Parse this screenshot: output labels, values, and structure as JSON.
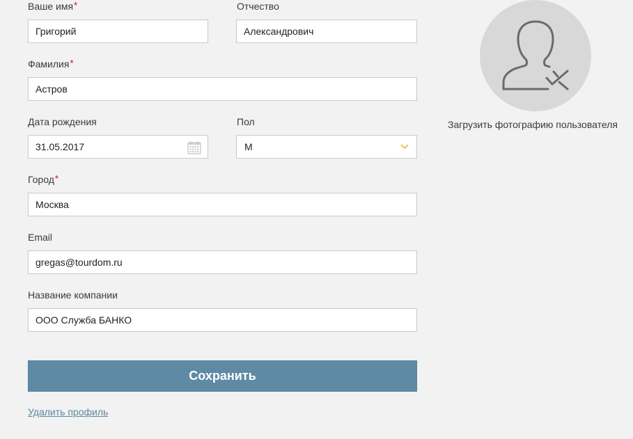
{
  "form": {
    "first_name": {
      "label": "Ваше имя",
      "required_mark": "*",
      "value": "Григорий"
    },
    "patronymic": {
      "label": "Отчество",
      "value": "Александрович"
    },
    "last_name": {
      "label": "Фамилия",
      "required_mark": "*",
      "value": "Астров"
    },
    "birth_date": {
      "label": "Дата рождения",
      "value": "31.05.2017",
      "icon": "calendar-icon"
    },
    "gender": {
      "label": "Пол",
      "value": "М",
      "icon": "chevron-down-icon"
    },
    "city": {
      "label": "Город",
      "required_mark": "*",
      "value": "Москва"
    },
    "email": {
      "label": "Email",
      "value": "gregas@tourdom.ru"
    },
    "company": {
      "label": "Название компании",
      "value": "ООО Служба БАНКО"
    }
  },
  "actions": {
    "save_label": "Сохранить",
    "delete_label": "Удалить профиль"
  },
  "avatar": {
    "caption": "Загрузить фотографию пользователя",
    "icon": "user-check-icon"
  },
  "colors": {
    "background": "#f1f2f1",
    "button": "#5f8aa6",
    "link": "#5b85a3",
    "required": "#d0021b",
    "chevron": "#e5c65a",
    "avatar_bg": "#d8d8d8"
  }
}
